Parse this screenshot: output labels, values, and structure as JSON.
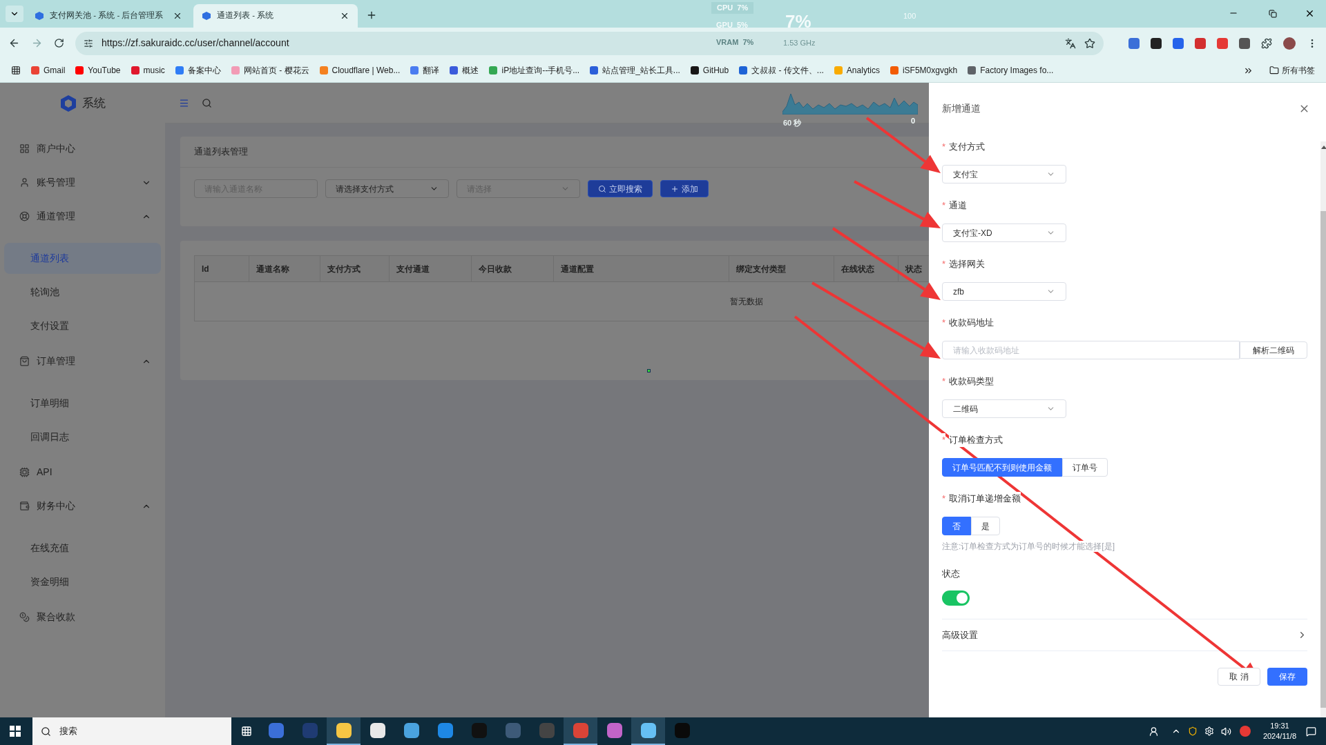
{
  "browser": {
    "tabs": [
      {
        "title": "支付网关池 - 系统 - 后台管理系",
        "selected": false
      },
      {
        "title": "通道列表 - 系统",
        "selected": true
      }
    ],
    "url": "https://zf.sakuraidc.cc/user/channel/account",
    "bookmarks": [
      {
        "label": "Gmail",
        "color": "#ea4335"
      },
      {
        "label": "YouTube",
        "color": "#ff0000"
      },
      {
        "label": "music",
        "color": "#e0182d"
      },
      {
        "label": "备案中心",
        "color": "#2f7df6"
      },
      {
        "label": "网站首页 - 樱花云",
        "color": "#f29bb5"
      },
      {
        "label": "Cloudflare | Web...",
        "color": "#f48120"
      },
      {
        "label": "翻译",
        "color": "#4a7cf0"
      },
      {
        "label": "概述",
        "color": "#3b5bdb"
      },
      {
        "label": "iP地址查询--手机号...",
        "color": "#34a853"
      },
      {
        "label": "站点管理_站长工具...",
        "color": "#2b5fd9"
      },
      {
        "label": "GitHub",
        "color": "#181717"
      },
      {
        "label": "文叔叔 - 传文件、...",
        "color": "#1e63d6"
      },
      {
        "label": "Analytics",
        "color": "#f9ab00"
      },
      {
        "label": "iSF5M0xgvgkh",
        "color": "#f25c05"
      },
      {
        "label": "Factory Images fo...",
        "color": "#5f6368"
      }
    ],
    "all_bookmarks": "所有书签"
  },
  "perf_overlay": {
    "cpu": "CPU  7%",
    "gpu": "GPU  5%",
    "vram": "VRAM  7%",
    "load": "7%",
    "max": "100",
    "clock": "1.53 GHz",
    "graph_span": "60 秒",
    "graph_value": "0"
  },
  "app": {
    "brand": "系统",
    "sidebar": [
      {
        "label": "商户中心",
        "selected": false
      },
      {
        "label": "账号管理",
        "selected": false,
        "expanded": false
      },
      {
        "label": "通道管理",
        "selected": false,
        "expanded": true,
        "children": [
          {
            "label": "通道列表",
            "selected": true
          },
          {
            "label": "轮询池",
            "selected": false
          },
          {
            "label": "支付设置",
            "selected": false
          }
        ]
      },
      {
        "label": "订单管理",
        "selected": false,
        "expanded": true,
        "children": [
          {
            "label": "订单明细",
            "selected": false
          },
          {
            "label": "回调日志",
            "selected": false
          }
        ]
      },
      {
        "label": "API",
        "selected": false
      },
      {
        "label": "财务中心",
        "selected": false,
        "expanded": true,
        "children": [
          {
            "label": "在线充值",
            "selected": false
          },
          {
            "label": "资金明细",
            "selected": false
          }
        ]
      },
      {
        "label": "聚合收款",
        "selected": false
      }
    ],
    "card_title": "通道列表管理",
    "filters": {
      "name_placeholder": "请输入通道名称",
      "method_value": "请选择支付方式",
      "type_placeholder": "请选择",
      "search_button": "立即搜索",
      "add_button": "添加"
    },
    "table": {
      "columns": [
        "Id",
        "通道名称",
        "支付方式",
        "支付通道",
        "今日收款",
        "通道配置",
        "绑定支付类型",
        "在线状态",
        "状态"
      ],
      "empty_text": "暂无数据"
    }
  },
  "drawer": {
    "title": "新增通道",
    "fields": [
      {
        "kind": "select",
        "label": "支付方式",
        "mark": "*",
        "value": "支付宝"
      },
      {
        "kind": "select",
        "label": "通道",
        "mark": "*",
        "value": "支付宝-XD"
      },
      {
        "kind": "select",
        "label": "选择网关",
        "mark": "*",
        "value": "zfb"
      },
      {
        "kind": "input",
        "label": "收款码地址",
        "mark": "*",
        "placeholder": "请输入收款码地址",
        "button": "解析二维码"
      },
      {
        "kind": "select",
        "label": "收款码类型",
        "mark": "*",
        "value": "二维码"
      },
      {
        "kind": "segmented",
        "label": "订单检查方式",
        "mark": "*",
        "options": [
          {
            "label": "订单号匹配不到则使用金额",
            "selected": true
          },
          {
            "label": "订单号",
            "selected": false
          }
        ]
      },
      {
        "kind": "segmented",
        "label": "取消订单递增金额",
        "mark": "*",
        "options": [
          {
            "label": "否",
            "selected": true
          },
          {
            "label": "是",
            "selected": false
          }
        ],
        "note": "注意:订单检查方式为订单号的时候才能选择[是]"
      },
      {
        "kind": "switch",
        "label": "状态",
        "on": true
      }
    ],
    "advanced": "高级设置",
    "cancel": "取 消",
    "save": "保存"
  },
  "taskbar": {
    "search": "搜索",
    "apps": [
      {
        "color": "#3b6fd8",
        "running": false
      },
      {
        "color": "#1f3b73",
        "running": false
      },
      {
        "color": "#f6c644",
        "running": true
      },
      {
        "color": "#e8e8e8",
        "running": false
      },
      {
        "color": "#4aa3df",
        "running": false
      },
      {
        "color": "#1e88e5",
        "running": false
      },
      {
        "color": "#111111",
        "running": false
      },
      {
        "color": "#3d5a78",
        "running": false
      },
      {
        "color": "#444444",
        "running": false
      },
      {
        "color": "#db4437",
        "running": true
      },
      {
        "color": "#c264c8",
        "running": false
      },
      {
        "color": "#66c0f4",
        "running": true
      },
      {
        "color": "#0a0a0a",
        "running": false
      }
    ],
    "time": "19:31",
    "date": "2024/11/8"
  }
}
